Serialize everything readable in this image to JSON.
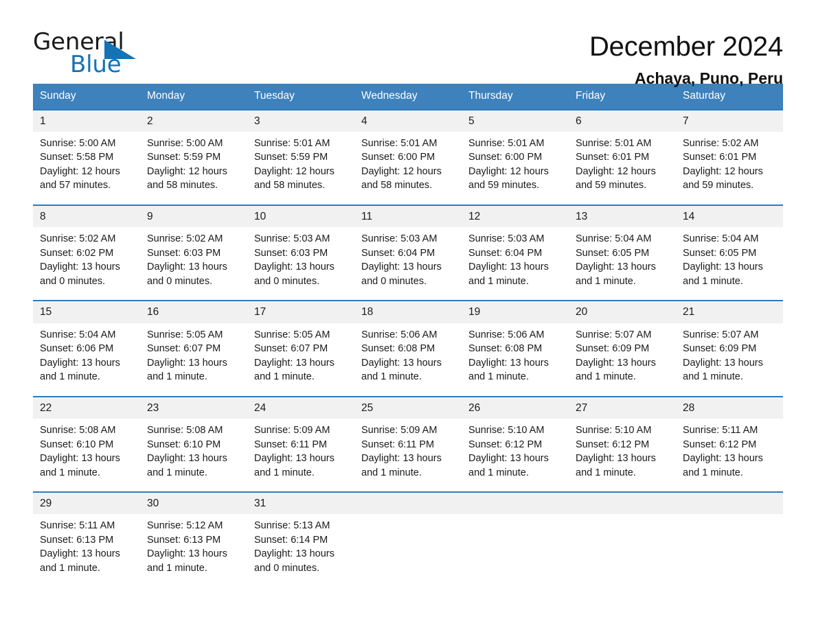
{
  "brand": {
    "word_one": "General",
    "word_two": "Blue",
    "flag_icon": "triangle-flag-icon",
    "accent_color": "#1473b5"
  },
  "header": {
    "title": "December 2024",
    "subtitle": "Achaya, Puno, Peru"
  },
  "calendar": {
    "header_bg": "#3d81bd",
    "date_band_bg": "#f1f1f1",
    "row_rule_color": "#2f7ab9",
    "day_names": [
      "Sunday",
      "Monday",
      "Tuesday",
      "Wednesday",
      "Thursday",
      "Friday",
      "Saturday"
    ],
    "weeks": [
      {
        "dates": [
          "1",
          "2",
          "3",
          "4",
          "5",
          "6",
          "7"
        ],
        "cells": [
          {
            "sunrise": "Sunrise: 5:00 AM",
            "sunset": "Sunset: 5:58 PM",
            "daylight_1": "Daylight: 12 hours",
            "daylight_2": "and 57 minutes."
          },
          {
            "sunrise": "Sunrise: 5:00 AM",
            "sunset": "Sunset: 5:59 PM",
            "daylight_1": "Daylight: 12 hours",
            "daylight_2": "and 58 minutes."
          },
          {
            "sunrise": "Sunrise: 5:01 AM",
            "sunset": "Sunset: 5:59 PM",
            "daylight_1": "Daylight: 12 hours",
            "daylight_2": "and 58 minutes."
          },
          {
            "sunrise": "Sunrise: 5:01 AM",
            "sunset": "Sunset: 6:00 PM",
            "daylight_1": "Daylight: 12 hours",
            "daylight_2": "and 58 minutes."
          },
          {
            "sunrise": "Sunrise: 5:01 AM",
            "sunset": "Sunset: 6:00 PM",
            "daylight_1": "Daylight: 12 hours",
            "daylight_2": "and 59 minutes."
          },
          {
            "sunrise": "Sunrise: 5:01 AM",
            "sunset": "Sunset: 6:01 PM",
            "daylight_1": "Daylight: 12 hours",
            "daylight_2": "and 59 minutes."
          },
          {
            "sunrise": "Sunrise: 5:02 AM",
            "sunset": "Sunset: 6:01 PM",
            "daylight_1": "Daylight: 12 hours",
            "daylight_2": "and 59 minutes."
          }
        ]
      },
      {
        "dates": [
          "8",
          "9",
          "10",
          "11",
          "12",
          "13",
          "14"
        ],
        "cells": [
          {
            "sunrise": "Sunrise: 5:02 AM",
            "sunset": "Sunset: 6:02 PM",
            "daylight_1": "Daylight: 13 hours",
            "daylight_2": "and 0 minutes."
          },
          {
            "sunrise": "Sunrise: 5:02 AM",
            "sunset": "Sunset: 6:03 PM",
            "daylight_1": "Daylight: 13 hours",
            "daylight_2": "and 0 minutes."
          },
          {
            "sunrise": "Sunrise: 5:03 AM",
            "sunset": "Sunset: 6:03 PM",
            "daylight_1": "Daylight: 13 hours",
            "daylight_2": "and 0 minutes."
          },
          {
            "sunrise": "Sunrise: 5:03 AM",
            "sunset": "Sunset: 6:04 PM",
            "daylight_1": "Daylight: 13 hours",
            "daylight_2": "and 0 minutes."
          },
          {
            "sunrise": "Sunrise: 5:03 AM",
            "sunset": "Sunset: 6:04 PM",
            "daylight_1": "Daylight: 13 hours",
            "daylight_2": "and 1 minute."
          },
          {
            "sunrise": "Sunrise: 5:04 AM",
            "sunset": "Sunset: 6:05 PM",
            "daylight_1": "Daylight: 13 hours",
            "daylight_2": "and 1 minute."
          },
          {
            "sunrise": "Sunrise: 5:04 AM",
            "sunset": "Sunset: 6:05 PM",
            "daylight_1": "Daylight: 13 hours",
            "daylight_2": "and 1 minute."
          }
        ]
      },
      {
        "dates": [
          "15",
          "16",
          "17",
          "18",
          "19",
          "20",
          "21"
        ],
        "cells": [
          {
            "sunrise": "Sunrise: 5:04 AM",
            "sunset": "Sunset: 6:06 PM",
            "daylight_1": "Daylight: 13 hours",
            "daylight_2": "and 1 minute."
          },
          {
            "sunrise": "Sunrise: 5:05 AM",
            "sunset": "Sunset: 6:07 PM",
            "daylight_1": "Daylight: 13 hours",
            "daylight_2": "and 1 minute."
          },
          {
            "sunrise": "Sunrise: 5:05 AM",
            "sunset": "Sunset: 6:07 PM",
            "daylight_1": "Daylight: 13 hours",
            "daylight_2": "and 1 minute."
          },
          {
            "sunrise": "Sunrise: 5:06 AM",
            "sunset": "Sunset: 6:08 PM",
            "daylight_1": "Daylight: 13 hours",
            "daylight_2": "and 1 minute."
          },
          {
            "sunrise": "Sunrise: 5:06 AM",
            "sunset": "Sunset: 6:08 PM",
            "daylight_1": "Daylight: 13 hours",
            "daylight_2": "and 1 minute."
          },
          {
            "sunrise": "Sunrise: 5:07 AM",
            "sunset": "Sunset: 6:09 PM",
            "daylight_1": "Daylight: 13 hours",
            "daylight_2": "and 1 minute."
          },
          {
            "sunrise": "Sunrise: 5:07 AM",
            "sunset": "Sunset: 6:09 PM",
            "daylight_1": "Daylight: 13 hours",
            "daylight_2": "and 1 minute."
          }
        ]
      },
      {
        "dates": [
          "22",
          "23",
          "24",
          "25",
          "26",
          "27",
          "28"
        ],
        "cells": [
          {
            "sunrise": "Sunrise: 5:08 AM",
            "sunset": "Sunset: 6:10 PM",
            "daylight_1": "Daylight: 13 hours",
            "daylight_2": "and 1 minute."
          },
          {
            "sunrise": "Sunrise: 5:08 AM",
            "sunset": "Sunset: 6:10 PM",
            "daylight_1": "Daylight: 13 hours",
            "daylight_2": "and 1 minute."
          },
          {
            "sunrise": "Sunrise: 5:09 AM",
            "sunset": "Sunset: 6:11 PM",
            "daylight_1": "Daylight: 13 hours",
            "daylight_2": "and 1 minute."
          },
          {
            "sunrise": "Sunrise: 5:09 AM",
            "sunset": "Sunset: 6:11 PM",
            "daylight_1": "Daylight: 13 hours",
            "daylight_2": "and 1 minute."
          },
          {
            "sunrise": "Sunrise: 5:10 AM",
            "sunset": "Sunset: 6:12 PM",
            "daylight_1": "Daylight: 13 hours",
            "daylight_2": "and 1 minute."
          },
          {
            "sunrise": "Sunrise: 5:10 AM",
            "sunset": "Sunset: 6:12 PM",
            "daylight_1": "Daylight: 13 hours",
            "daylight_2": "and 1 minute."
          },
          {
            "sunrise": "Sunrise: 5:11 AM",
            "sunset": "Sunset: 6:12 PM",
            "daylight_1": "Daylight: 13 hours",
            "daylight_2": "and 1 minute."
          }
        ]
      },
      {
        "dates": [
          "29",
          "30",
          "31",
          "",
          "",
          "",
          ""
        ],
        "cells": [
          {
            "sunrise": "Sunrise: 5:11 AM",
            "sunset": "Sunset: 6:13 PM",
            "daylight_1": "Daylight: 13 hours",
            "daylight_2": "and 1 minute."
          },
          {
            "sunrise": "Sunrise: 5:12 AM",
            "sunset": "Sunset: 6:13 PM",
            "daylight_1": "Daylight: 13 hours",
            "daylight_2": "and 1 minute."
          },
          {
            "sunrise": "Sunrise: 5:13 AM",
            "sunset": "Sunset: 6:14 PM",
            "daylight_1": "Daylight: 13 hours",
            "daylight_2": "and 0 minutes."
          },
          {
            "sunrise": "",
            "sunset": "",
            "daylight_1": "",
            "daylight_2": ""
          },
          {
            "sunrise": "",
            "sunset": "",
            "daylight_1": "",
            "daylight_2": ""
          },
          {
            "sunrise": "",
            "sunset": "",
            "daylight_1": "",
            "daylight_2": ""
          },
          {
            "sunrise": "",
            "sunset": "",
            "daylight_1": "",
            "daylight_2": ""
          }
        ]
      }
    ]
  }
}
